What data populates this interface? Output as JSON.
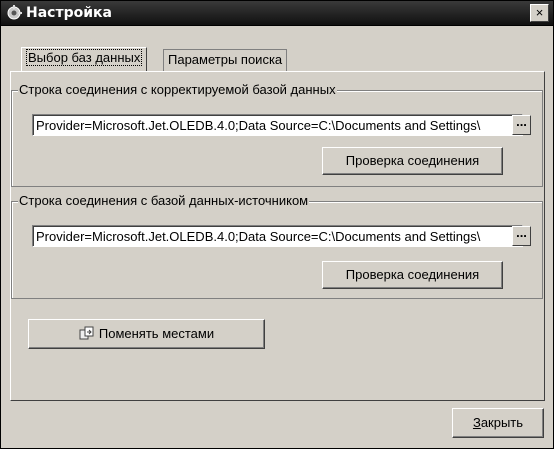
{
  "window": {
    "title": "Настройка",
    "close_label": "×"
  },
  "tabs": [
    {
      "label": "Выбор баз данных",
      "active": true
    },
    {
      "label": "Параметры поиска",
      "active": false
    }
  ],
  "target_group": {
    "legend": "Строка соединения с корректируемой базой данных",
    "connection_string": "Provider=Microsoft.Jet.OLEDB.4.0;Data Source=C:\\Documents and Settings\\",
    "browse_label": "...",
    "check_button": "Проверка соединения"
  },
  "source_group": {
    "legend": "Строка соединения с базой данных-источником",
    "connection_string": "Provider=Microsoft.Jet.OLEDB.4.0;Data Source=C:\\Documents and Settings\\",
    "browse_label": "...",
    "check_button": "Проверка соединения"
  },
  "swap_button": "Поменять местами",
  "close_button": {
    "hotkey": "З",
    "rest": "акрыть"
  }
}
